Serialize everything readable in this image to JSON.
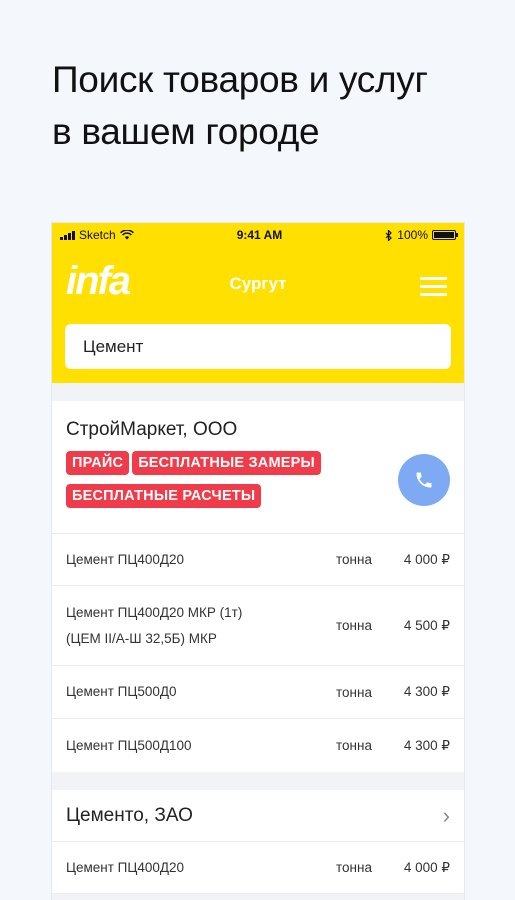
{
  "promo": {
    "line1": "Поиск товаров и услуг",
    "line2": "в вашем городе"
  },
  "status_bar": {
    "carrier": "Sketch",
    "time": "9:41 AM",
    "battery": "100%"
  },
  "header": {
    "logo": "infa",
    "city": "Сургут",
    "bg_color": "#ffe000"
  },
  "search": {
    "value": "Цемент"
  },
  "companies": [
    {
      "name": "СтройМаркет, ООО",
      "tags": [
        "ПРАЙС",
        "БЕСПЛАТНЫЕ ЗАМЕРЫ",
        "БЕСПЛАТНЫЕ РАСЧЕТЫ"
      ],
      "products": [
        {
          "name1": "Цемент ПЦ400Д20",
          "name2": "",
          "unit": "тонна",
          "price": "4 000 ₽"
        },
        {
          "name1": "Цемент ПЦ400Д20 МКР (1т)",
          "name2": "(ЦЕМ II/А-Ш 32,5Б) МКР",
          "unit": "тонна",
          "price": "4 500 ₽"
        },
        {
          "name1": "Цемент ПЦ500Д0",
          "name2": "",
          "unit": "тонна",
          "price": "4 300 ₽"
        },
        {
          "name1": "Цемент ПЦ500Д100",
          "name2": "",
          "unit": "тонна",
          "price": "4 300 ₽"
        }
      ]
    },
    {
      "name": "Цементо, ЗАО",
      "products": [
        {
          "name1": "Цемент ПЦ400Д20",
          "unit": "тонна",
          "price": "4 000 ₽"
        }
      ]
    }
  ],
  "colors": {
    "tag": "#ef3b4a",
    "call_button": "#7ea9f3"
  },
  "icons": [
    "signal-icon",
    "wifi-icon",
    "bluetooth-icon",
    "battery-icon",
    "menu-icon",
    "phone-icon",
    "chevron-right-icon"
  ]
}
